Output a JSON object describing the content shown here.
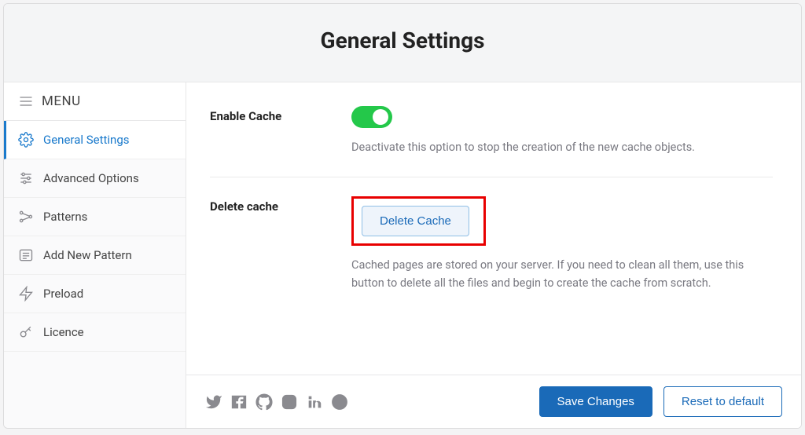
{
  "header": {
    "title": "General Settings"
  },
  "sidebar": {
    "menu_label": "MENU",
    "items": [
      {
        "label": "General Settings"
      },
      {
        "label": "Advanced Options"
      },
      {
        "label": "Patterns"
      },
      {
        "label": "Add New Pattern"
      },
      {
        "label": "Preload"
      },
      {
        "label": "Licence"
      }
    ]
  },
  "settings": {
    "enable_cache": {
      "label": "Enable Cache",
      "help": "Deactivate this option to stop the creation of the new cache objects."
    },
    "delete_cache": {
      "label": "Delete cache",
      "button": "Delete Cache",
      "help": "Cached pages are stored on your server. If you need to clean all them, use this button to delete all the files and begin to create the cache from scratch."
    }
  },
  "footer": {
    "save": "Save Changes",
    "reset": "Reset to default"
  }
}
